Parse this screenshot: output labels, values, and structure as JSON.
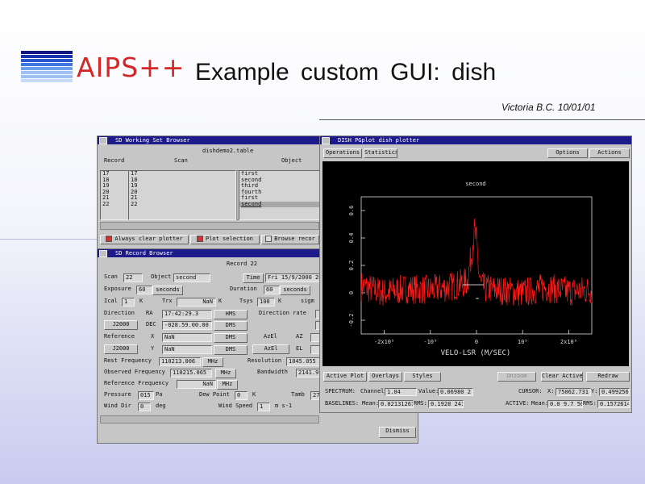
{
  "slide": {
    "logo_text": "AIPS++",
    "title": "Example custom GUI: dish",
    "subtitle": "Victoria B.C. 10/01/01",
    "colors": {
      "logo_red": "#d42828",
      "title_bar": "#1d1b8a",
      "plot_trace": "#ff1a1a"
    }
  },
  "wsb": {
    "title": "SD Working Set Browser",
    "table_name": "dishdemo2.table",
    "col_headers": [
      "Record",
      "Scan",
      "Object"
    ],
    "rows": [
      {
        "record": "17",
        "scan": "17",
        "object": "first"
      },
      {
        "record": "18",
        "scan": "18",
        "object": "second"
      },
      {
        "record": "19",
        "scan": "19",
        "object": "third"
      },
      {
        "record": "20",
        "scan": "20",
        "object": "fourth"
      },
      {
        "record": "21",
        "scan": "21",
        "object": "first"
      },
      {
        "record": "22",
        "scan": "22",
        "object": "second"
      }
    ],
    "always_clear": "Always clear plotter",
    "plot_selection": "Plot selection",
    "browse": "Browse recor"
  },
  "rb": {
    "title": "SD Record Browser",
    "record_label": "Record 22",
    "scan_label": "Scan",
    "scan_value": "22",
    "object_label": "Object",
    "object_value": "second",
    "time_btn": "Time",
    "time_value": "Fri 15/9/2000 20:20:4",
    "exposure_label": "Exposure",
    "exposure_value": "60",
    "exposure_unit": "seconds",
    "duration_label": "Duration",
    "duration_value": "60",
    "duration_unit": "seconds",
    "ical_label": "Ical",
    "ical_value": "1",
    "ical_unit": "K",
    "trx_label": "Trx",
    "trx_value": "NaN",
    "trx_unit": "K",
    "tsys_label": "Tsys",
    "tsys_value": "100",
    "tsys_unit": "K",
    "sigma_label": "sigm",
    "direction_label": "Direction",
    "ra_label": "RA",
    "ra_value": "17:42:29.3",
    "hms_btn": "HMS",
    "dec_label": "DEC",
    "dec_value": "-028.59.00.00",
    "dms_btn": "DMS",
    "direction_rate_label": "Direction rate",
    "j2000_btn": "J2000",
    "reference_label": "Reference",
    "x_label": "X",
    "x_value": "NaN",
    "y_label": "Y",
    "y_value": "NaN",
    "azel_btn": "AzEl",
    "az_label": "AZ",
    "el_label": "EL",
    "rest_label": "Rest Frequency",
    "rest_value": "110213.006",
    "rest_unit": "MHz",
    "resolution_label": "Resolution",
    "resolution_value": "1045.055",
    "obs_label": "Observed Frequency",
    "obs_value": "110215.065",
    "obs_unit": "MHz",
    "bw_label": "Bandwidth",
    "bw_value": "2141.9",
    "ref_freq_label": "Reference Frequency",
    "ref_freq_value": "NaN",
    "ref_freq_unit": "MHz",
    "pressure_label": "Pressure",
    "pressure_value": "015",
    "pressure_unit": "Pa",
    "dew_label": "Dew Point",
    "dew_value": "0",
    "dew_unit": "K",
    "tamb_label": "Tamb",
    "tamb_value": "27",
    "wind_dir_label": "Wind Dir",
    "wind_dir_value": "0",
    "wind_dir_unit": "deg",
    "wind_speed_label": "Wind Speed",
    "wind_speed_value": "1",
    "wind_speed_unit": "m s-1",
    "dismiss": "Dismiss"
  },
  "plotter": {
    "title": "DISH PGplot dish plotter",
    "menu": [
      "Operations",
      "Statistics"
    ],
    "menu_right": [
      "Options",
      "Actions"
    ],
    "plot_label": "second",
    "y_ticks": [
      "0.6",
      "0.4",
      "0.2",
      "0",
      "-0.2"
    ],
    "x_ticks": [
      "-2x10⁵",
      "-10⁵",
      "0",
      "10⁵",
      "2x10⁵"
    ],
    "xlabel": "VELO-LSR (M/SEC)",
    "bottom_buttons": [
      "Active Plot",
      "Overlays",
      "Styles",
      "Unzoom",
      "Clear Active",
      "Redraw"
    ],
    "spectrum_label": "SPECTRUM:",
    "channel_label": "Channel:",
    "channel_value": "1.04",
    "value_label": "Value:",
    "value_value": "0.06980 2",
    "cursor_label": "CURSOR:",
    "cx_label": "X:",
    "cx_value": "75062.731",
    "cy_label": "Y:",
    "cy_value": "0.4992562",
    "baselines_label": "BASELINES:",
    "mean_label": "Mean:",
    "mean_value": "0.02131261",
    "rms_label": "RMS:",
    "rms_value": "0.1928 241",
    "active_label": "ACTIVE:",
    "amean_label": "Mean:",
    "amean_value": "0.0 9.7 500",
    "arms_label": "RMS:",
    "arms_value": "0.1572614"
  },
  "chart_data": {
    "type": "line",
    "xlabel": "VELO-LSR (M/SEC)",
    "ylabel": "",
    "xlim": [
      -250000,
      250000
    ],
    "ylim": [
      -0.3,
      0.7
    ],
    "series": [
      {
        "name": "second",
        "x": [
          -250000,
          -200000,
          -150000,
          -100000,
          -50000,
          -20000,
          -10000,
          -5000,
          0,
          5000,
          10000,
          20000,
          50000,
          100000,
          150000,
          200000,
          250000
        ],
        "y": [
          0.05,
          0.0,
          0.03,
          0.02,
          0.05,
          0.08,
          0.3,
          0.45,
          0.38,
          0.15,
          0.05,
          0.03,
          0.02,
          0.0,
          0.04,
          0.01,
          0.02
        ]
      }
    ]
  }
}
